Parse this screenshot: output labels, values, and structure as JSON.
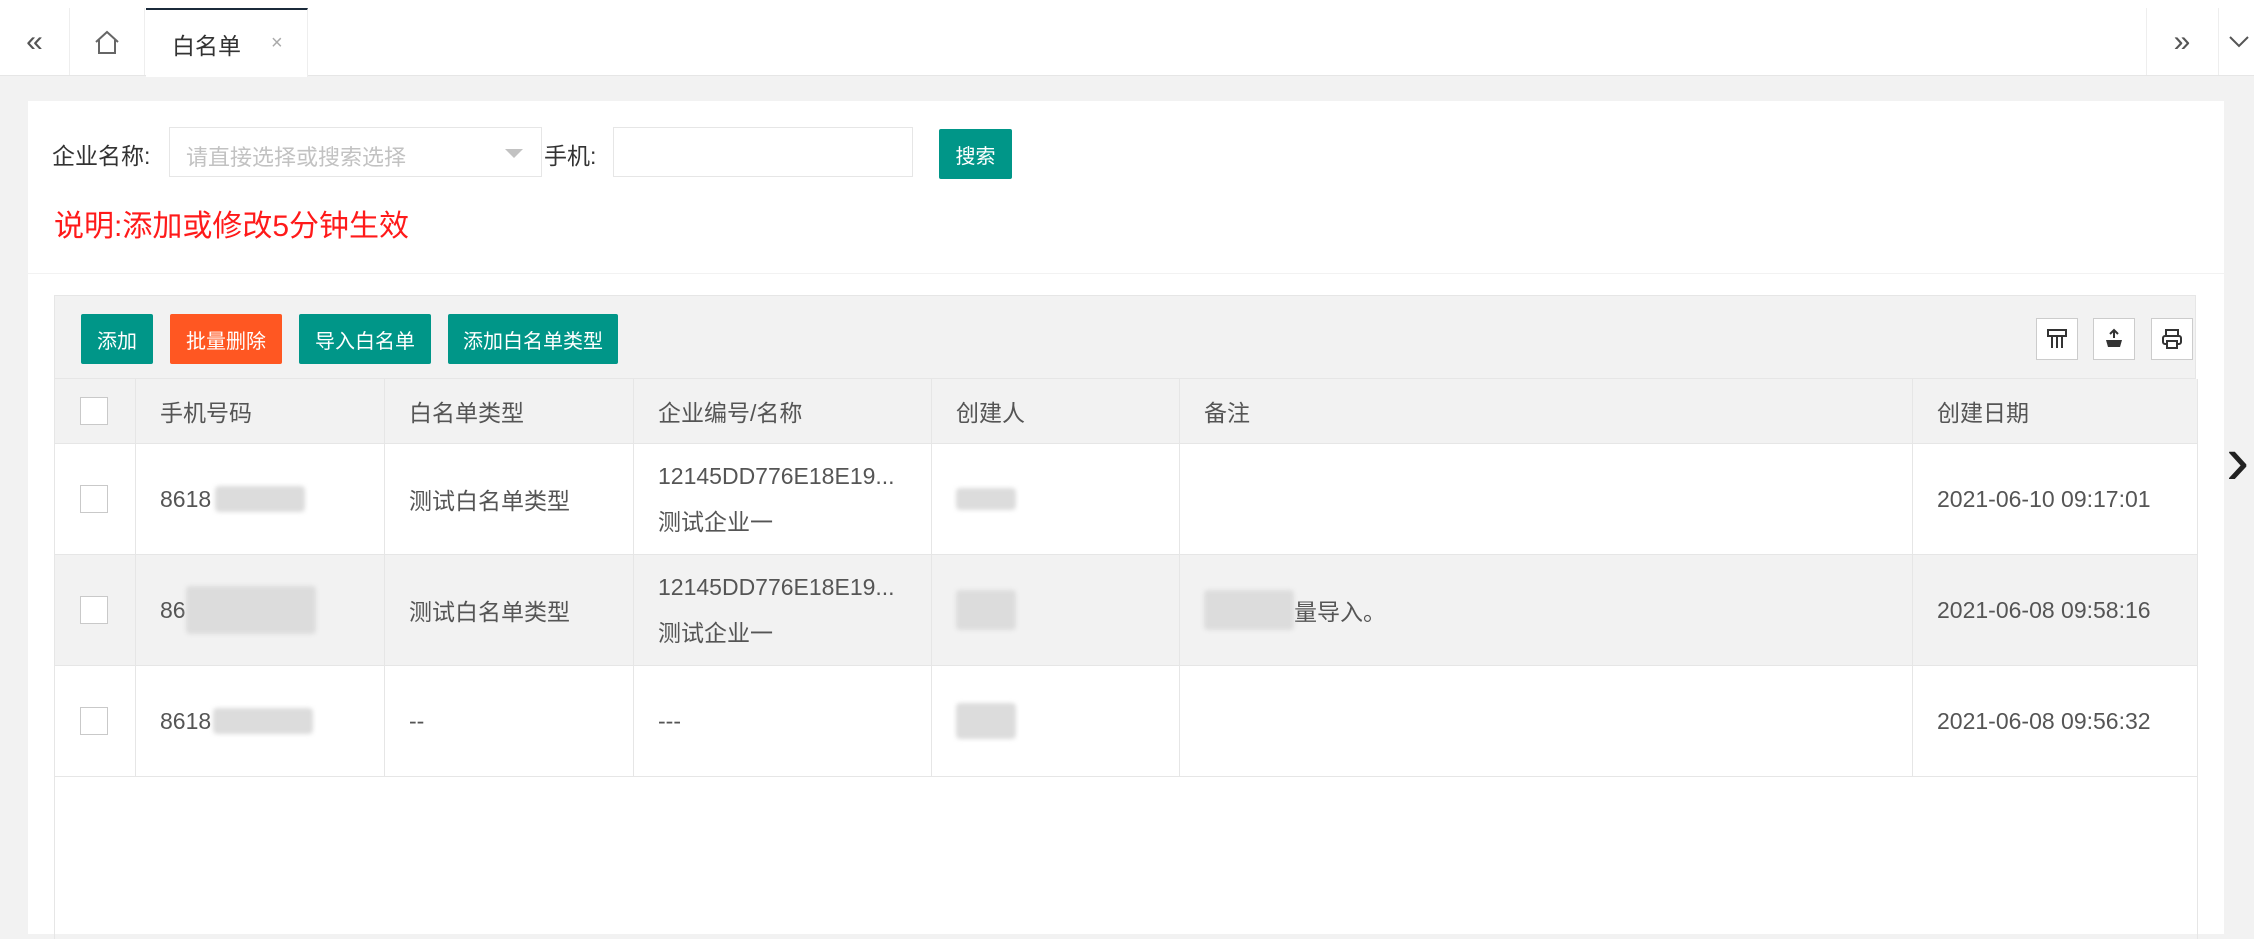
{
  "tabbar": {
    "prev_icon": "double-chevron-left-icon",
    "home_icon": "home-icon",
    "active_tab": {
      "label": "白名单",
      "close": "×"
    },
    "next_icon": "double-chevron-right-icon",
    "dropdown_icon": "chevron-down-icon"
  },
  "filter": {
    "company_label": "企业名称:",
    "company_placeholder": "请直接选择或搜索选择",
    "phone_label": "手机:",
    "phone_value": "",
    "search_button": "搜索",
    "note": "说明:添加或修改5分钟生效"
  },
  "toolbar": {
    "add": "添加",
    "batch_delete": "批量删除",
    "import": "导入白名单",
    "add_type": "添加白名单类型",
    "icons": [
      "columns-icon",
      "export-icon",
      "print-icon"
    ]
  },
  "table": {
    "columns": [
      "手机号码",
      "白名单类型",
      "企业编号/名称",
      "创建人",
      "备注",
      "创建日期"
    ],
    "rows": [
      {
        "phone": "8618",
        "type": "测试白名单类型",
        "company_id": "12145DD776E18E19...",
        "company_name": "测试企业一",
        "creator": "",
        "remark": "",
        "created": "2021-06-10 09:17:01"
      },
      {
        "phone": "86",
        "type": "测试白名单类型",
        "company_id": "12145DD776E18E19...",
        "company_name": "测试企业一",
        "creator": "",
        "remark": "量导入。",
        "created": "2021-06-08 09:58:16"
      },
      {
        "phone": "8618",
        "type": "--",
        "company_id": "",
        "company_name": "---",
        "creator": "",
        "remark": "",
        "created": "2021-06-08 09:56:32"
      }
    ]
  },
  "colors": {
    "primary": "#009688",
    "danger": "#ff5722",
    "note": "#ff1a1a"
  }
}
